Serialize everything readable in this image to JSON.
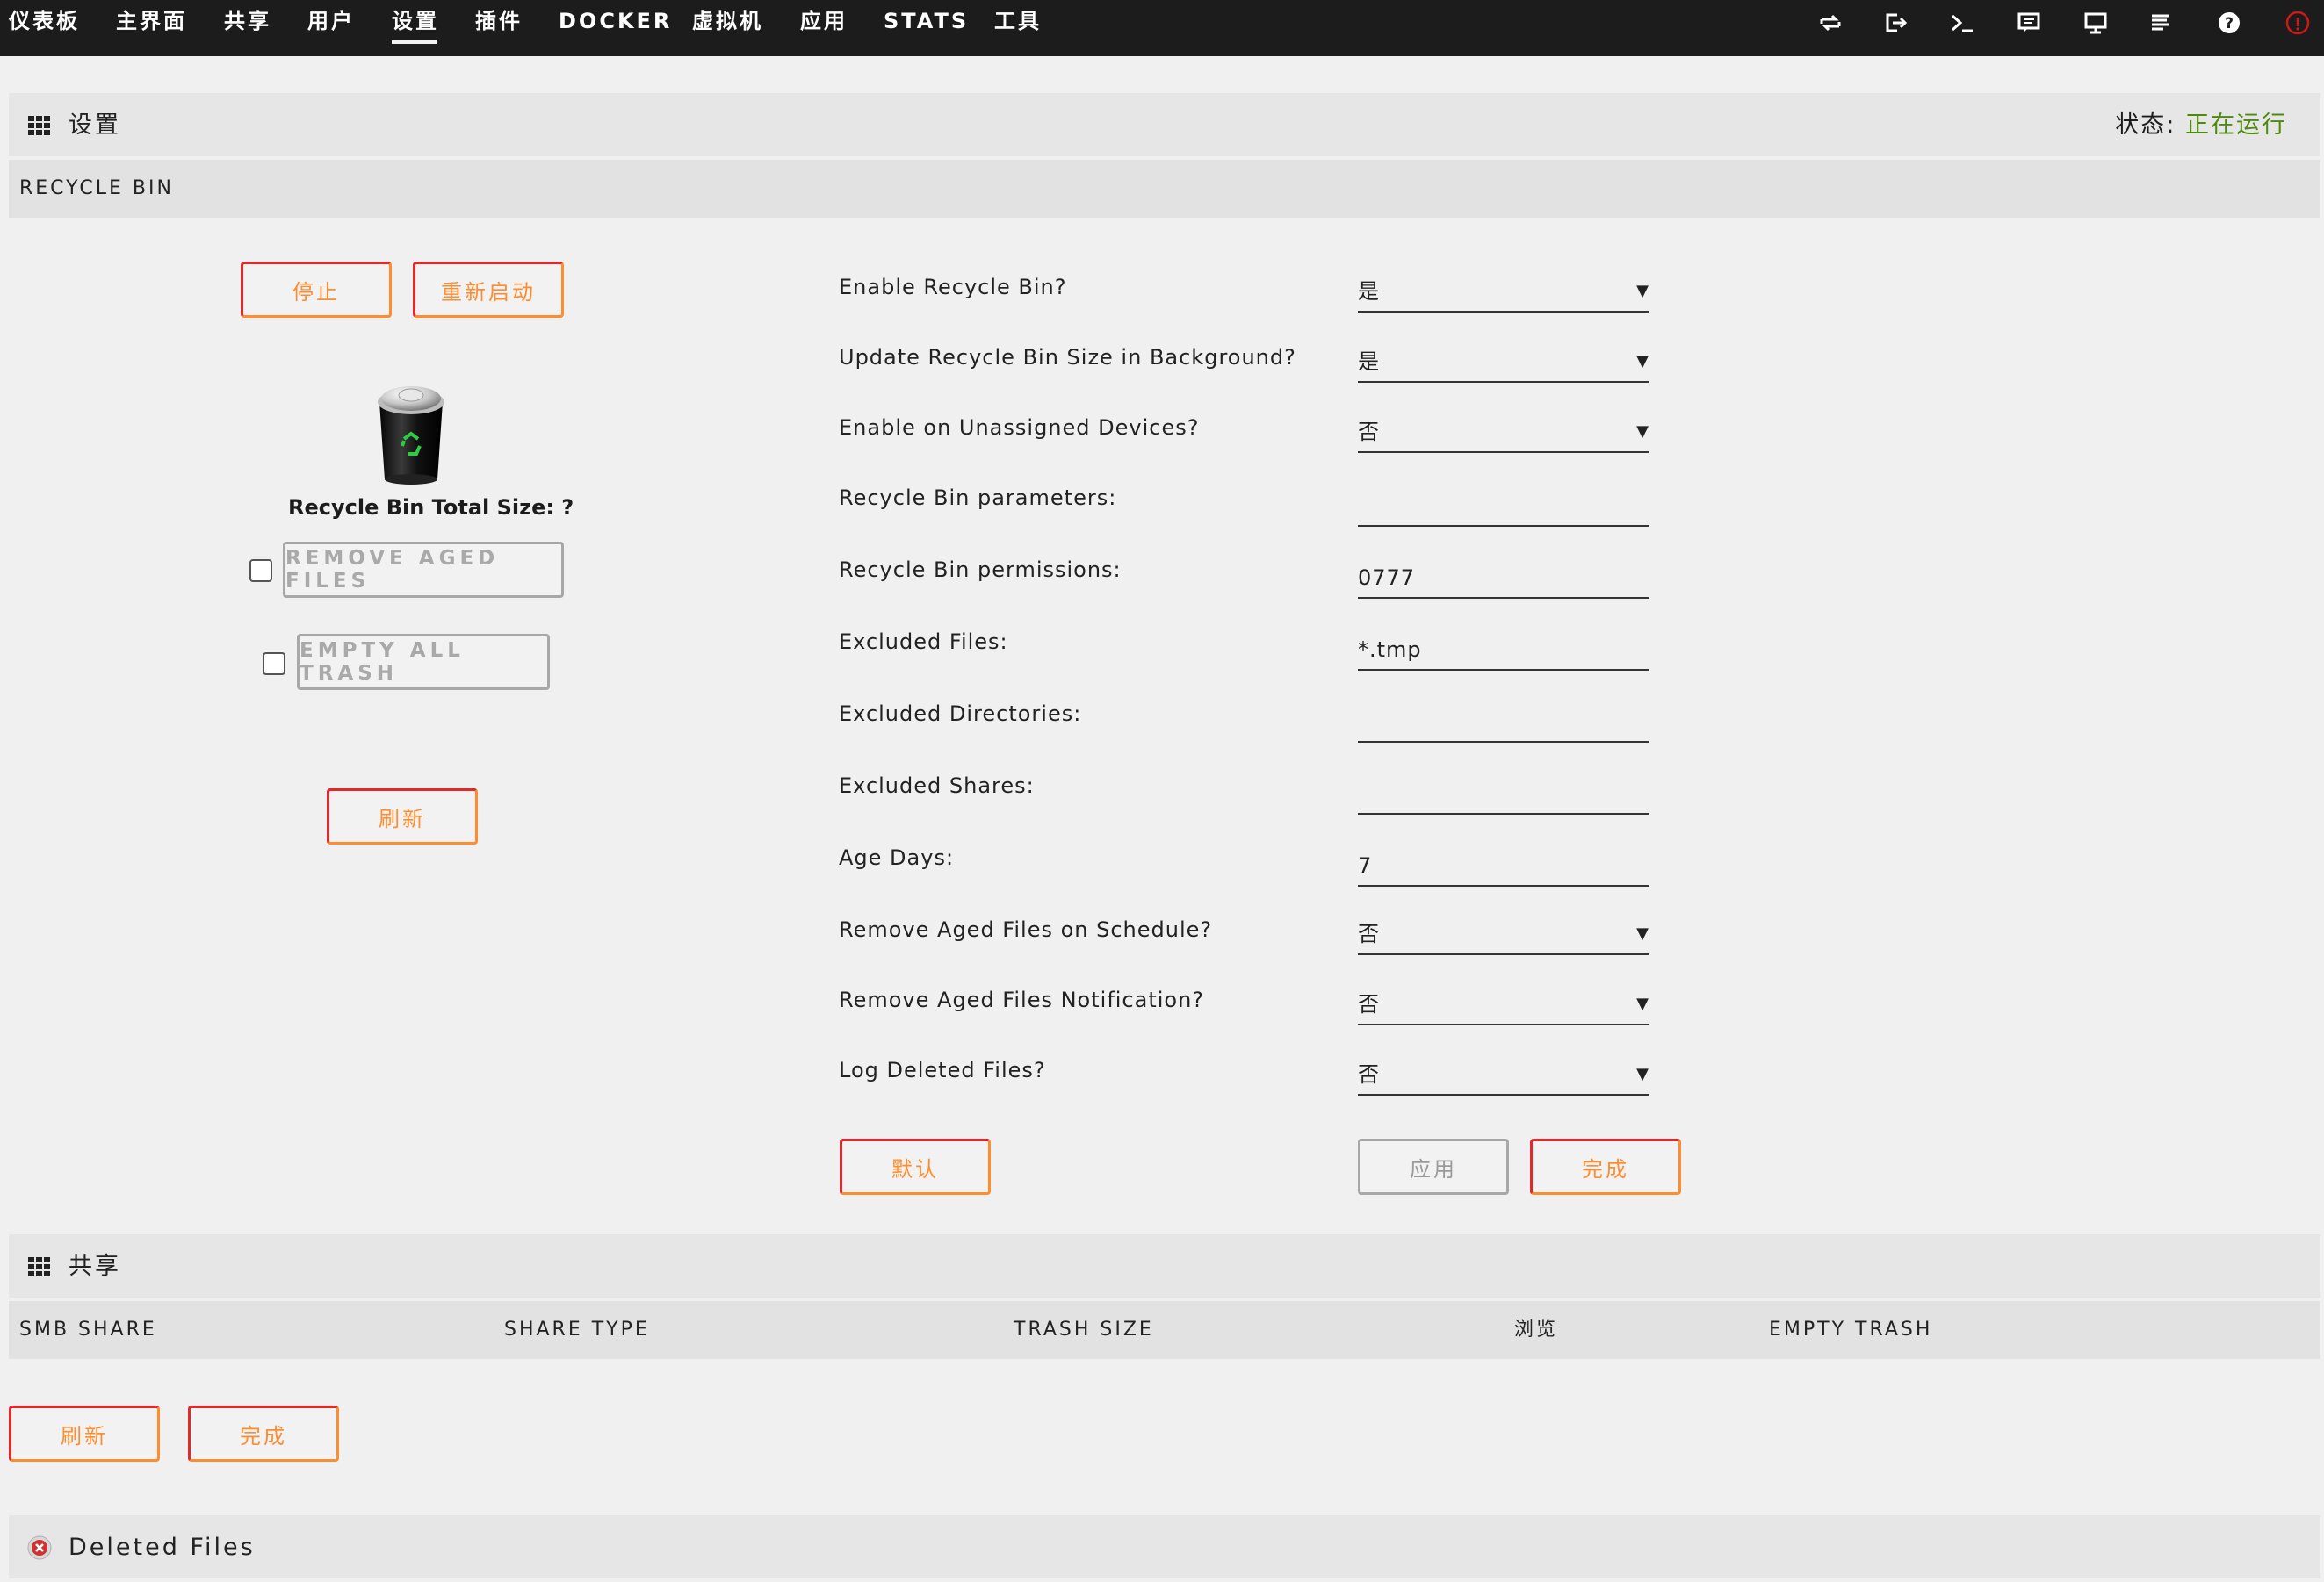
{
  "nav": {
    "items": [
      "仪表板",
      "主界面",
      "共享",
      "用户",
      "设置",
      "插件",
      "DOCKER",
      "虚拟机",
      "应用",
      "STATS",
      "工具"
    ],
    "active_index": 4,
    "right_icons": [
      "sync-icon",
      "logout-icon",
      "terminal-icon",
      "feedback-icon",
      "monitor-icon",
      "log-icon",
      "help-icon",
      "info-icon"
    ]
  },
  "settings_section": {
    "title": "设置",
    "status_label": "状态:",
    "status_value": "正在运行",
    "status_color": "#4f8a10"
  },
  "recycle_bin_header": "RECYCLE BIN",
  "left_panel": {
    "stop_label": "停止",
    "restart_label": "重新启动",
    "total_size_label": "Recycle Bin Total Size: ?",
    "remove_aged_label": "REMOVE AGED FILES",
    "empty_trash_label": "EMPTY ALL TRASH",
    "refresh_label": "刷新"
  },
  "form": {
    "fields": [
      {
        "label": "Enable Recycle Bin?",
        "value": "是",
        "type": "select"
      },
      {
        "label": "Update Recycle Bin Size in Background?",
        "value": "是",
        "type": "select"
      },
      {
        "label": "Enable on Unassigned Devices?",
        "value": "否",
        "type": "select"
      },
      {
        "label": "Recycle Bin parameters:",
        "value": "",
        "type": "text"
      },
      {
        "label": "Recycle Bin permissions:",
        "value": "0777",
        "type": "text"
      },
      {
        "label": "Excluded Files:",
        "value": "*.tmp",
        "type": "text"
      },
      {
        "label": "Excluded Directories:",
        "value": "",
        "type": "text"
      },
      {
        "label": "Excluded Shares:",
        "value": "",
        "type": "text"
      },
      {
        "label": "Age Days:",
        "value": "7",
        "type": "text"
      },
      {
        "label": "Remove Aged Files on Schedule?",
        "value": "否",
        "type": "select"
      },
      {
        "label": "Remove Aged Files Notification?",
        "value": "否",
        "type": "select"
      },
      {
        "label": "Log Deleted Files?",
        "value": "否",
        "type": "select"
      }
    ],
    "default_label": "默认",
    "apply_label": "应用",
    "done_label": "完成"
  },
  "share_section": {
    "title": "共享",
    "columns": [
      "SMB SHARE",
      "SHARE TYPE",
      "TRASH SIZE",
      "浏览",
      "EMPTY TRASH"
    ],
    "refresh_label": "刷新",
    "done_label": "完成"
  },
  "deleted_section": {
    "title": "Deleted Files"
  },
  "colors": {
    "accent_orange": "#ff8c2f",
    "accent_red": "#e22828",
    "nav_bg": "#1c1c1c"
  }
}
